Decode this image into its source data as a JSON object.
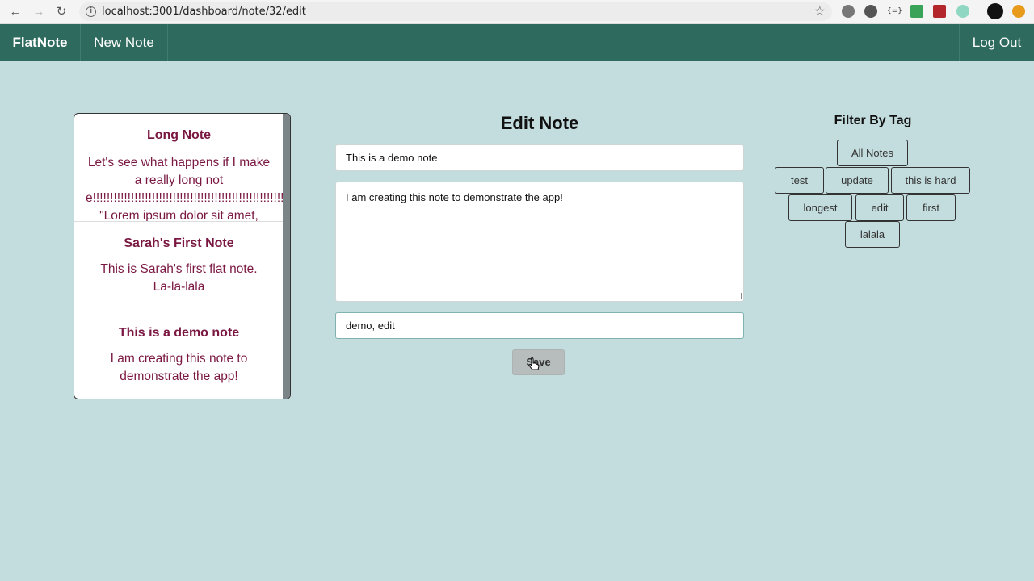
{
  "browser": {
    "url": "localhost:3001/dashboard/note/32/edit",
    "back_icon": "arrow-left-icon",
    "forward_icon": "arrow-right-icon",
    "reload_icon": "reload-icon"
  },
  "appbar": {
    "brand": "FlatNote",
    "new_note": "New Note",
    "log_out": "Log Out"
  },
  "notes": [
    {
      "title": "Long Note",
      "body": "Let's see what happens if I make a really long note!!!!!!!!!!!!!!!!!!!!!!!!!!!!!!!!!!!!!!!!!!!!!!!!!!!!!!!!!!!!!!!!!!!!!!!! \"Lorem ipsum dolor sit amet,"
    },
    {
      "title": "Sarah's First Note",
      "body": "This is Sarah's first flat note. La-la-lala"
    },
    {
      "title": "This is a demo note",
      "body": "I am creating this note to demonstrate the app!"
    }
  ],
  "edit": {
    "heading": "Edit Note",
    "title_value": "This is a demo note",
    "body_value": "I am creating this note to demonstrate the app!",
    "tags_value": "demo, edit",
    "save_label": "Save"
  },
  "filter": {
    "heading": "Filter By Tag",
    "tags": [
      "All Notes",
      "test",
      "update",
      "this is hard",
      "longest",
      "edit",
      "first",
      "lalala"
    ]
  },
  "colors": {
    "background": "#c3dcdd",
    "navbar": "#2e6b5e",
    "note_text": "#7a1842"
  }
}
